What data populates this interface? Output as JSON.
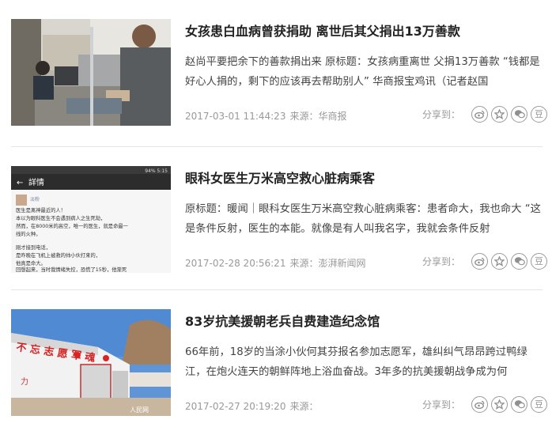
{
  "share_label": "分享到：",
  "share_icons": [
    "weibo-icon",
    "star-icon",
    "wechat-icon",
    "douban-icon"
  ],
  "share_glyphs": {
    "douban": "豆"
  },
  "articles": [
    {
      "title": "女孩患白血病曾获捐助 离世后其父捐出13万善款",
      "summary": "赵尚平要把余下的善款捐出来 原标题：女孩病重离世 父捐13万善款 “钱都是好心人捐的，剩下的应该再去帮助别人” 华商报宝鸡讯（记者赵国",
      "date": "2017-03-01 11:44:23",
      "source": "来源：华商报"
    },
    {
      "title": "眼科女医生万米高空救心脏病乘客",
      "summary": "原标题：暖闻｜眼科女医生万米高空救心脏病乘客：患者命大，我也命大 “这是条件反射，医生的本能。就像是有人叫我名字，我就会条件反射",
      "date": "2017-02-28 20:56:21",
      "source": "来源：澎湃新闻网",
      "thumb_text": {
        "status": "94% 5:15",
        "back": "←",
        "header": "詳情",
        "username": "淡粉",
        "lines": [
          "医生是离神最近的人！",
          "本以为眼科医生不会遇到病人之生死劫，",
          "然而，在8000米的高空，唯一的医生，就是命最一",
          "线的火种。",
          "",
          "刚才接到电话，",
          "是昨晚在飞机上被救的帅小伙打来的，",
          "他真是命大。",
          "回想起来，当时我情绪失控，恐慌了15秒，他渐死"
        ]
      }
    },
    {
      "title": "83岁抗美援朝老兵自费建造纪念馆",
      "summary": "66年前，18岁的当涂小伙何其芬报名参加志愿军，雄纠纠气昂昂跨过鸭绿江，在炮火连天的朝鲜阵地上浴血奋战。3年多的抗美援朝战争成为何",
      "date": "2017-02-27 20:19:20",
      "source": "来源：",
      "thumb_text": {
        "wall": "不 忘 志 愿 军 魂",
        "left": "力",
        "watermark": "人民网"
      }
    }
  ]
}
